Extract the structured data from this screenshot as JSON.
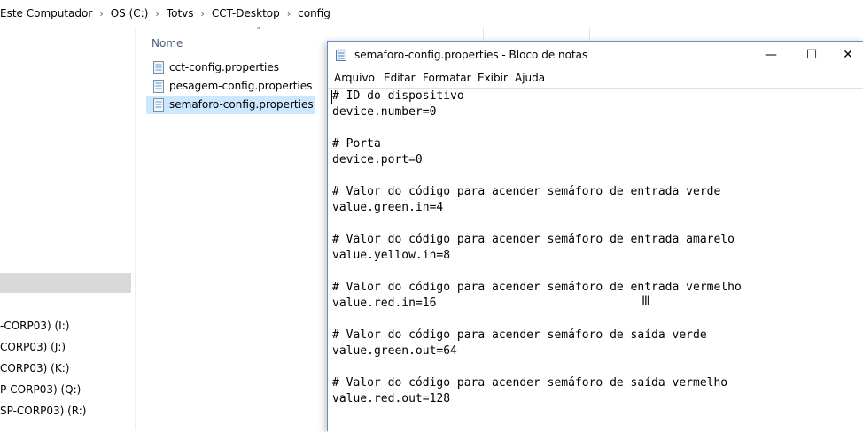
{
  "explorer": {
    "breadcrumb": [
      "Este Computador",
      "OS (C:)",
      "Totvs",
      "CCT-Desktop",
      "config"
    ],
    "separator": "›",
    "column_name": "Nome",
    "sort_icon": "chevron-up-icon",
    "drives": [
      "-CORP03) (I:)",
      "CORP03) (J:)",
      "CORP03) (K:)",
      "P-CORP03) (Q:)",
      "SP-CORP03) (R:)"
    ],
    "files": [
      {
        "name": "cct-config.properties",
        "selected": false
      },
      {
        "name": "pesagem-config.properties",
        "selected": false
      },
      {
        "name": "semaforo-config.properties",
        "selected": true
      }
    ]
  },
  "notepad": {
    "title": "semaforo-config.properties - Bloco de notas",
    "buttons": {
      "minimize": "—",
      "maximize": "☐",
      "close": "✕"
    },
    "menu": [
      "Arquivo",
      "Editar",
      "Formatar",
      "Exibir",
      "Ajuda"
    ],
    "content": "# ID do dispositivo\ndevice.number=0\n\n# Porta\ndevice.port=0\n\n# Valor do código para acender semáforo de entrada verde\nvalue.green.in=4\n\n# Valor do código para acender semáforo de entrada amarelo\nvalue.yellow.in=8\n\n# Valor do código para acender semáforo de entrada vermelho\nvalue.red.in=16\n\n# Valor do código para acender semáforo de saída verde\nvalue.green.out=64\n\n# Valor do código para acender semáforo de saída vermelho\nvalue.red.out=128"
  },
  "colors": {
    "selection": "#cce8ff",
    "accent": "#5b8fd6"
  }
}
